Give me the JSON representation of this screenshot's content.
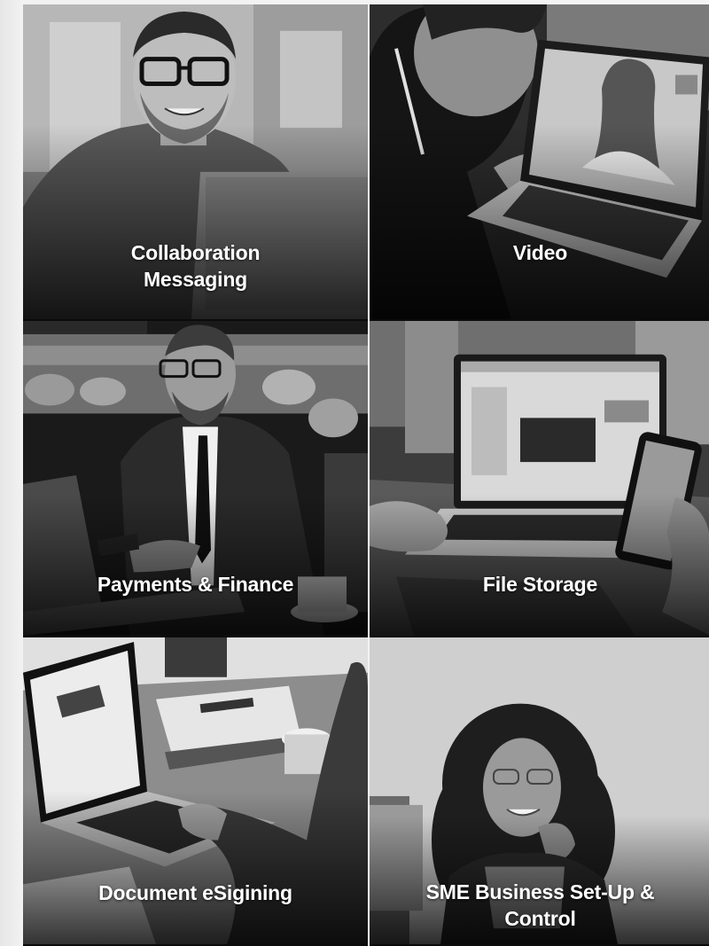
{
  "services": [
    {
      "id": "collaboration",
      "lines": [
        "Collaboration",
        "Messaging"
      ]
    },
    {
      "id": "video",
      "lines": [
        "Video"
      ]
    },
    {
      "id": "payments",
      "lines": [
        "Payments & Finance"
      ]
    },
    {
      "id": "file-storage",
      "lines": [
        "File Storage"
      ]
    },
    {
      "id": "document",
      "lines": [
        "Document eSigining"
      ]
    },
    {
      "id": "sme",
      "lines": [
        "SME Business Set-Up &",
        "Control"
      ]
    }
  ],
  "colors": {
    "label_text": "#ffffff",
    "tile_tone": "grayscale"
  },
  "photos": [
    "smiling-man-glasses-laptop-photo",
    "woman-video-call-laptop-photo",
    "businessman-phone-laptop-photo",
    "laptop-phone-desk-photo",
    "laptop-desk-typing-photo",
    "smiling-woman-curly-hair-photo"
  ]
}
